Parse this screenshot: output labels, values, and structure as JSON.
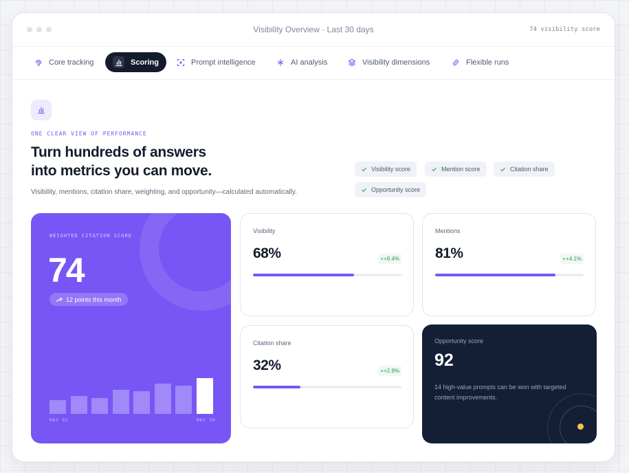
{
  "window": {
    "title": "Visibility Overview · Last 30 days",
    "meta": "74 visibility score"
  },
  "tabs": [
    {
      "label": "Core tracking",
      "icon": "fingerprint-icon"
    },
    {
      "label": "Scoring",
      "icon": "bar-chart-icon"
    },
    {
      "label": "Prompt intelligence",
      "icon": "scan-icon"
    },
    {
      "label": "AI analysis",
      "icon": "sparkle-icon"
    },
    {
      "label": "Visibility dimensions",
      "icon": "layers-icon"
    },
    {
      "label": "Flexible runs",
      "icon": "link-icon"
    }
  ],
  "active_tab": "Scoring",
  "section": {
    "icon": "bar-chart-icon",
    "eyebrow": "ONE CLEAR VIEW OF PERFORMANCE",
    "headline_line1": "Turn hundreds of answers",
    "headline_line2": "into metrics you can move.",
    "subtext": "Visibility, mentions, citation share, weighting, and opportunity—calculated automatically."
  },
  "chips": [
    "Visibility score",
    "Mention score",
    "Citation share",
    "Opportunity score"
  ],
  "hero": {
    "label": "WEIGHTED CITATION SCORE",
    "score": "74",
    "trend": "12 points this month",
    "bars": [
      0.31,
      0.41,
      0.36,
      0.55,
      0.51,
      0.69,
      0.64,
      0.82
    ],
    "axis_start": "MAY 01",
    "axis_end": "MAY 30"
  },
  "metrics": [
    {
      "label": "Visibility",
      "value": "68%",
      "delta": "++8.4%",
      "progress": 0.68
    },
    {
      "label": "Mentions",
      "value": "81%",
      "delta": "++4.1%",
      "progress": 0.81
    },
    {
      "label": "Citation share",
      "value": "32%",
      "delta": "++2.8%",
      "progress": 0.32
    }
  ],
  "opportunity": {
    "label": "Opportunity score",
    "value": "92",
    "description": "14 high-value prompts can be won with targeted content improvements."
  },
  "colors": {
    "accent": "#7856f5",
    "dark": "#141f35",
    "positive": "#2f9a5a",
    "indicator": "#f5c542"
  }
}
